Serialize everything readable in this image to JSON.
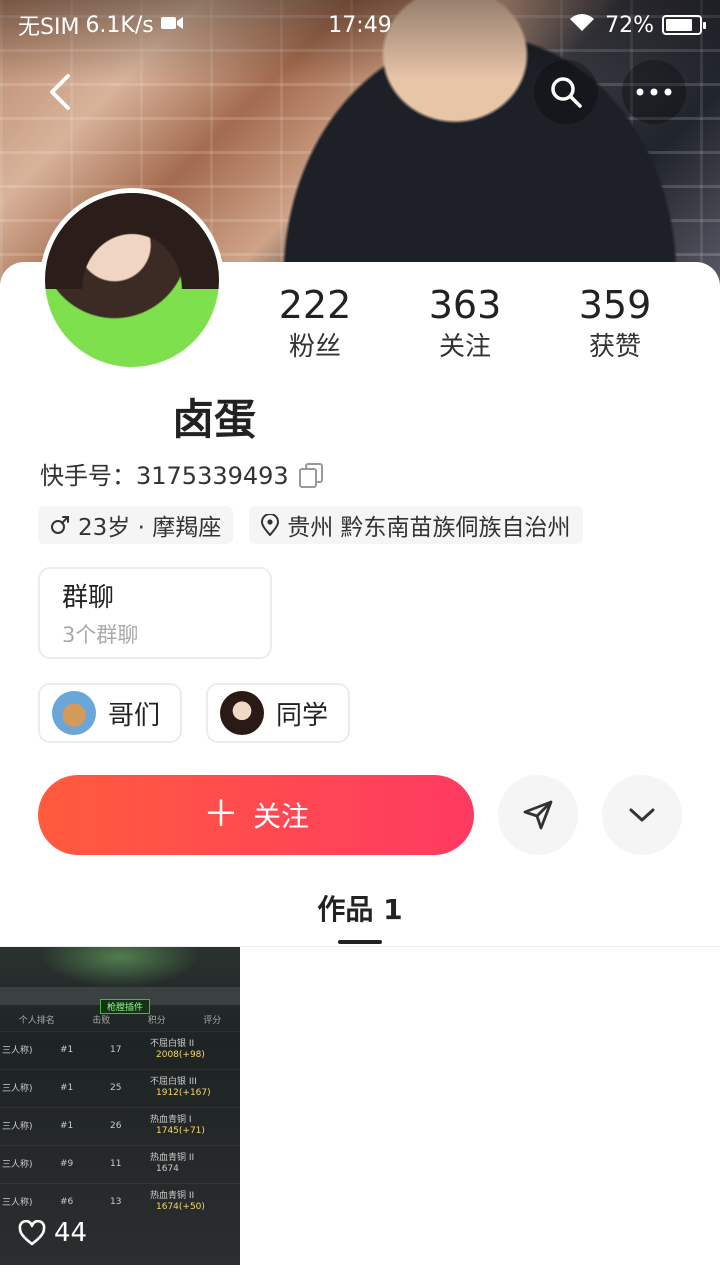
{
  "status_bar": {
    "carrier": "无SIM",
    "speed": "6.1K/s",
    "time": "17:49",
    "battery": "72%"
  },
  "profile": {
    "name": "卤蛋",
    "kuaishou_id_label": "快手号：",
    "kuaishou_id": "3175339493",
    "stats": [
      {
        "num": "222",
        "label": "粉丝"
      },
      {
        "num": "363",
        "label": "关注"
      },
      {
        "num": "359",
        "label": "获赞"
      }
    ],
    "tags": {
      "age_sign": "23岁 · 摩羯座",
      "location": "贵州 黔东南苗族侗族自治州"
    },
    "group_card": {
      "title": "群聊",
      "subtitle": "3个群聊"
    },
    "circles": [
      {
        "label": "哥们"
      },
      {
        "label": "同学"
      }
    ]
  },
  "actions": {
    "follow_label": "关注"
  },
  "tabs": {
    "works_label": "作品 1"
  },
  "works": [
    {
      "likes": "44",
      "overlay_tag": "枪膛插件",
      "headers": [
        "个人排名",
        "击败",
        "积分",
        "评分"
      ],
      "rows": [
        {
          "mode": "三人称)",
          "rank": "#1",
          "kills": "17",
          "tier": "不屈白银 II",
          "score": "2008(+98)"
        },
        {
          "mode": "三人称)",
          "rank": "#1",
          "kills": "25",
          "tier": "不屈白银 III",
          "score": "1912(+167)"
        },
        {
          "mode": "三人称)",
          "rank": "#1",
          "kills": "26",
          "tier": "热血青铜 I",
          "score": "1745(+71)"
        },
        {
          "mode": "三人称)",
          "rank": "#9",
          "kills": "11",
          "tier": "热血青铜 II",
          "score": "1674"
        },
        {
          "mode": "三人称)",
          "rank": "#6",
          "kills": "13",
          "tier": "热血青铜 II",
          "score": "1674(+50)"
        }
      ]
    }
  ],
  "colors": {
    "follow_gradient_start": "#ff5b3d",
    "follow_gradient_end": "#ff3a62",
    "tag_bg": "#f5f5f5"
  }
}
